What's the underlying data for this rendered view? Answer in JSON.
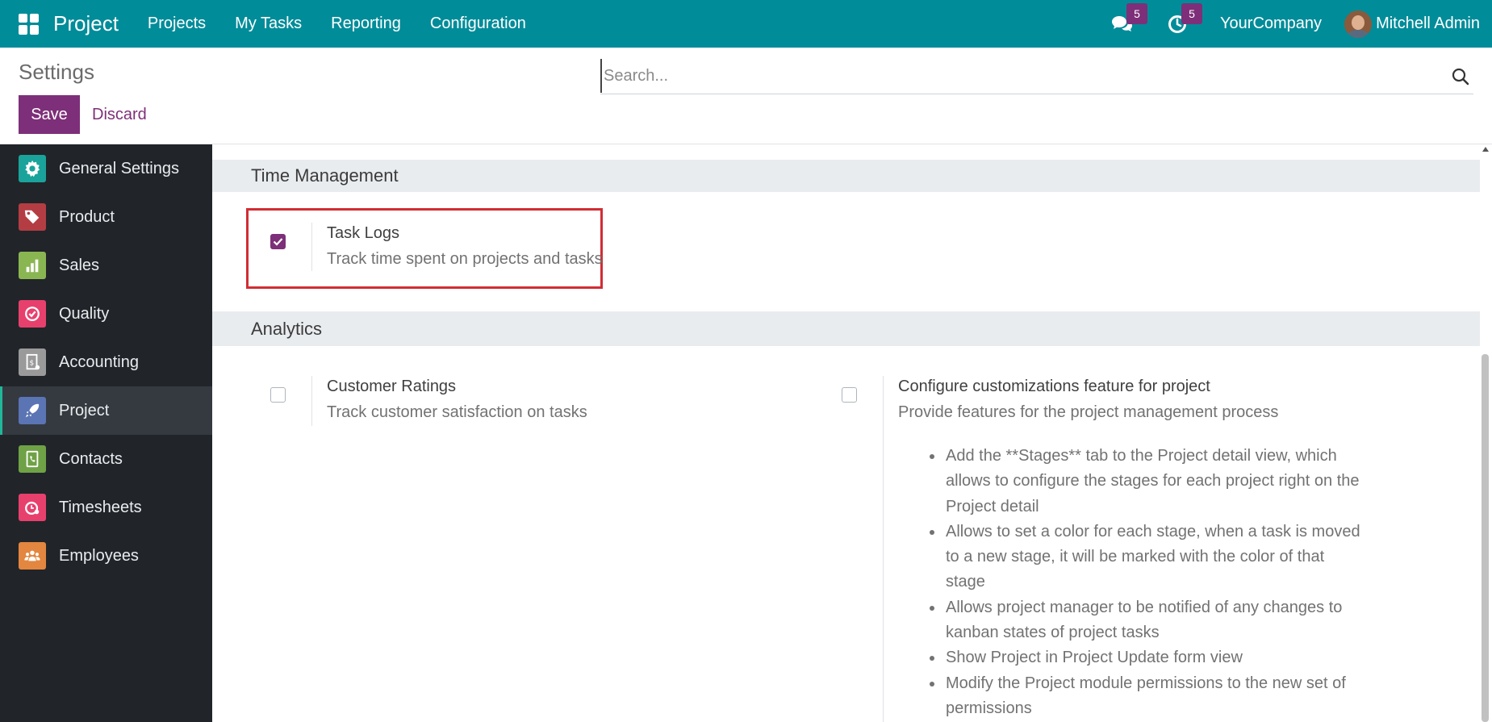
{
  "navbar": {
    "brand": "Project",
    "menu": [
      "Projects",
      "My Tasks",
      "Reporting",
      "Configuration"
    ],
    "messages_badge": "5",
    "activities_badge": "5",
    "company": "YourCompany",
    "user": "Mitchell Admin"
  },
  "control": {
    "breadcrumb": "Settings",
    "save_label": "Save",
    "discard_label": "Discard",
    "search_placeholder": "Search..."
  },
  "sidebar": {
    "items": [
      {
        "label": "General Settings",
        "icon": "gear-icon",
        "color": "#1aa39b"
      },
      {
        "label": "Product",
        "icon": "tags-icon",
        "color": "#b43d43"
      },
      {
        "label": "Sales",
        "icon": "chart-icon",
        "color": "#8ab652"
      },
      {
        "label": "Quality",
        "icon": "check-badge-icon",
        "color": "#e8406d"
      },
      {
        "label": "Accounting",
        "icon": "invoice-icon",
        "color": "#9a9a9a"
      },
      {
        "label": "Project",
        "icon": "rocket-icon",
        "color": "#5a74b4",
        "active": true
      },
      {
        "label": "Contacts",
        "icon": "phonebook-icon",
        "color": "#6fa246"
      },
      {
        "label": "Timesheets",
        "icon": "stopwatch-icon",
        "color": "#e8406d"
      },
      {
        "label": "Employees",
        "icon": "people-icon",
        "color": "#e3863f"
      }
    ]
  },
  "sections": {
    "time_management": {
      "title": "Time Management",
      "task_logs": {
        "label": "Task Logs",
        "description": "Track time spent on projects and tasks",
        "checked": true
      }
    },
    "analytics": {
      "title": "Analytics",
      "customer_ratings": {
        "label": "Customer Ratings",
        "description": "Track customer satisfaction on tasks",
        "checked": false
      },
      "customizations": {
        "label": "Configure customizations feature for project",
        "description": "Provide features for the project management process",
        "checked": false,
        "bullets": [
          "Add the **Stages** tab to the Project detail view, which allows to configure the stages for each project right on the Project detail",
          "Allows to set a color for each stage, when a task is moved to a new stage, it will be marked with the color of that stage",
          "Allows project manager to be notified of any changes to kanban states of project tasks",
          "Show Project in Project Update form view",
          "Modify the Project module permissions to the new set of permissions"
        ]
      }
    }
  },
  "colors": {
    "navbar": "#018c99",
    "primary": "#7e2f79",
    "sidebar": "#212529",
    "highlight": "#d12d33"
  }
}
